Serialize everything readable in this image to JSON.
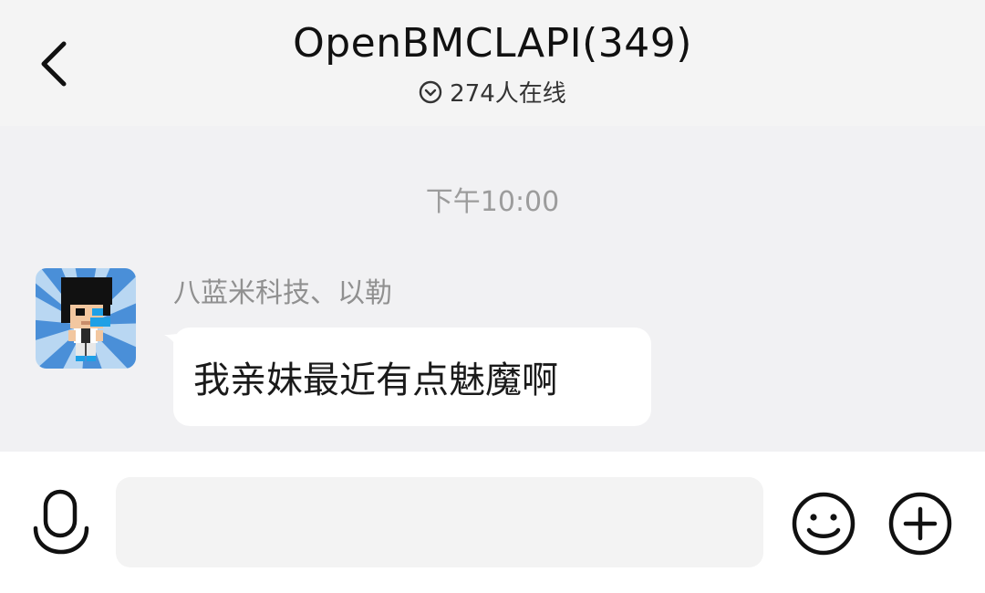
{
  "header": {
    "title": "OpenBMCLAPI(349)",
    "online_text": "274人在线",
    "back_icon": "chevron-left-icon",
    "status_icon": "chevron-down-circle-icon"
  },
  "chat": {
    "timestamp": "下午10:00",
    "messages": [
      {
        "sender": "八蓝米科技、以勒",
        "text": "我亲妹最近有点魅魔啊",
        "avatar_icon": "pixel-character-avatar"
      }
    ]
  },
  "input_bar": {
    "value": "",
    "placeholder": "",
    "voice_icon": "microphone-icon",
    "emoji_icon": "smiley-icon",
    "more_icon": "plus-circle-icon"
  },
  "colors": {
    "header_bg": "#f4f4f4",
    "chat_bg": "#f1f1f3",
    "bubble_bg": "#ffffff",
    "muted_text": "#9c9c9c",
    "avatar_sky": "#4a8fd8"
  }
}
